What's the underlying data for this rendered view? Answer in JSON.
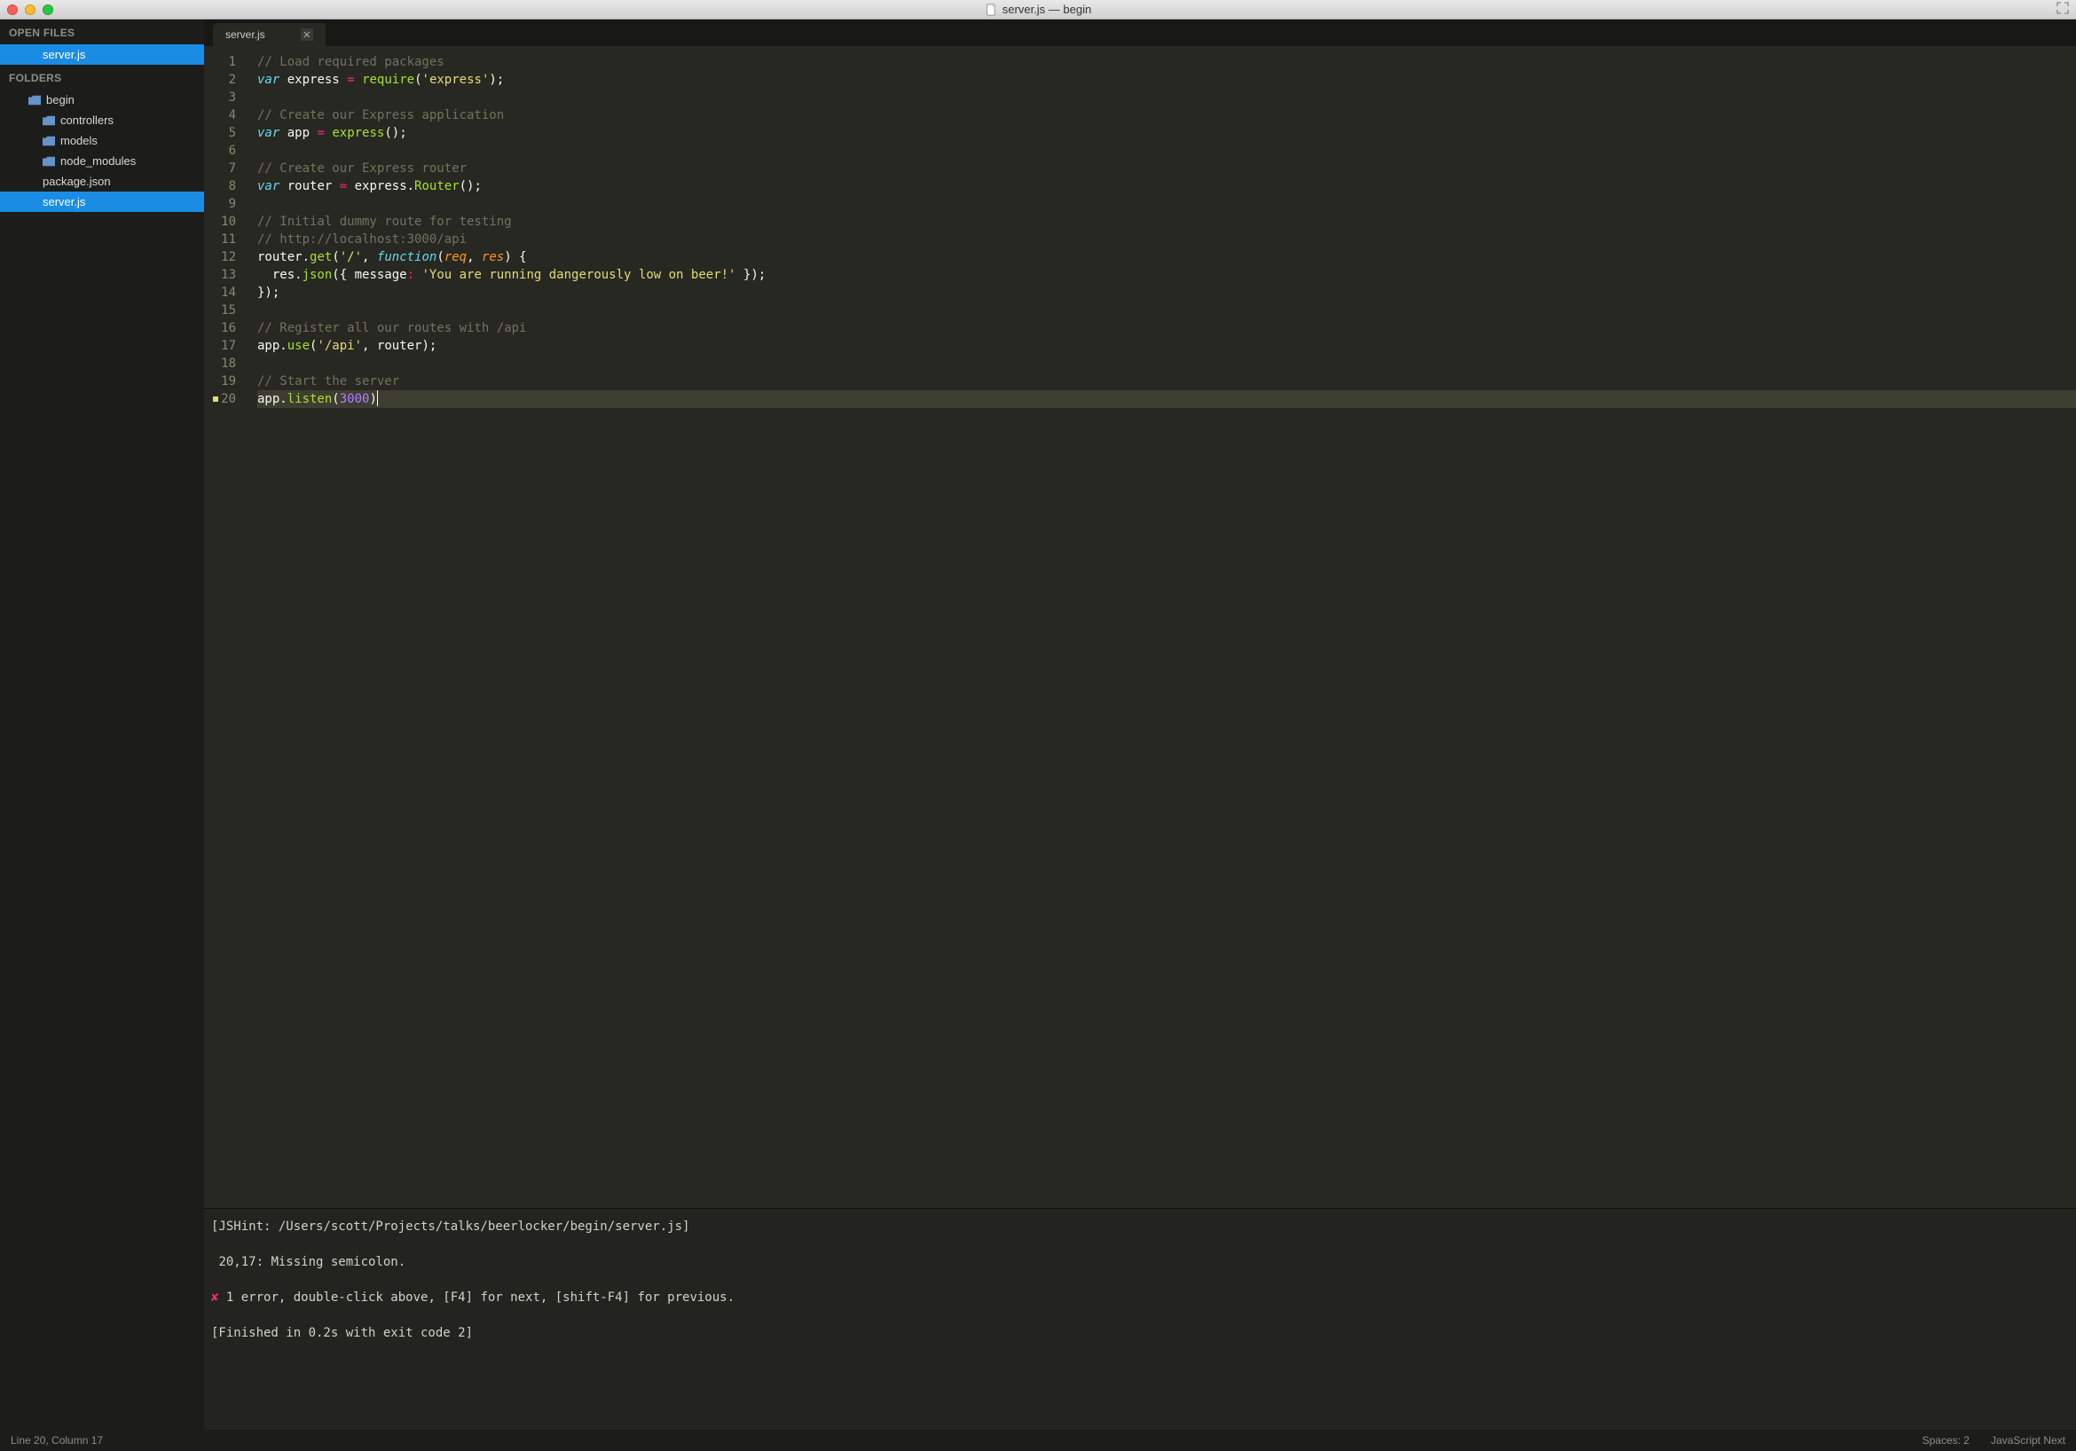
{
  "window": {
    "title": "server.js — begin"
  },
  "sidebar": {
    "open_files_label": "OPEN FILES",
    "folders_label": "FOLDERS",
    "open_files": [
      {
        "name": "server.js",
        "selected": true
      }
    ],
    "root_folder": "begin",
    "tree": [
      {
        "name": "controllers",
        "type": "folder"
      },
      {
        "name": "models",
        "type": "folder"
      },
      {
        "name": "node_modules",
        "type": "folder"
      },
      {
        "name": "package.json",
        "type": "file"
      },
      {
        "name": "server.js",
        "type": "file",
        "selected": true
      }
    ]
  },
  "tabs": [
    {
      "label": "server.js"
    }
  ],
  "code": {
    "lines": [
      [
        {
          "t": "// Load required packages",
          "c": "comment"
        }
      ],
      [
        {
          "t": "var",
          "c": "keyword"
        },
        {
          "t": " ",
          "c": "default"
        },
        {
          "t": "express",
          "c": "default"
        },
        {
          "t": " ",
          "c": "default"
        },
        {
          "t": "=",
          "c": "keyword2"
        },
        {
          "t": " ",
          "c": "default"
        },
        {
          "t": "require",
          "c": "func"
        },
        {
          "t": "(",
          "c": "default"
        },
        {
          "t": "'express'",
          "c": "string"
        },
        {
          "t": ");",
          "c": "default"
        }
      ],
      [],
      [
        {
          "t": "// Create our Express application",
          "c": "comment"
        }
      ],
      [
        {
          "t": "var",
          "c": "keyword"
        },
        {
          "t": " ",
          "c": "default"
        },
        {
          "t": "app",
          "c": "default"
        },
        {
          "t": " ",
          "c": "default"
        },
        {
          "t": "=",
          "c": "keyword2"
        },
        {
          "t": " ",
          "c": "default"
        },
        {
          "t": "express",
          "c": "func"
        },
        {
          "t": "();",
          "c": "default"
        }
      ],
      [],
      [
        {
          "t": "// Create our Express router",
          "c": "comment"
        }
      ],
      [
        {
          "t": "var",
          "c": "keyword"
        },
        {
          "t": " ",
          "c": "default"
        },
        {
          "t": "router",
          "c": "default"
        },
        {
          "t": " ",
          "c": "default"
        },
        {
          "t": "=",
          "c": "keyword2"
        },
        {
          "t": " express.",
          "c": "default"
        },
        {
          "t": "Router",
          "c": "func"
        },
        {
          "t": "();",
          "c": "default"
        }
      ],
      [],
      [
        {
          "t": "// Initial dummy route for testing",
          "c": "comment"
        }
      ],
      [
        {
          "t": "// http://localhost:3000/api",
          "c": "comment"
        }
      ],
      [
        {
          "t": "router.",
          "c": "default"
        },
        {
          "t": "get",
          "c": "func"
        },
        {
          "t": "(",
          "c": "default"
        },
        {
          "t": "'/'",
          "c": "string"
        },
        {
          "t": ", ",
          "c": "default"
        },
        {
          "t": "function",
          "c": "keyword"
        },
        {
          "t": "(",
          "c": "default"
        },
        {
          "t": "req",
          "c": "param"
        },
        {
          "t": ", ",
          "c": "default"
        },
        {
          "t": "res",
          "c": "param"
        },
        {
          "t": ") {",
          "c": "default"
        }
      ],
      [
        {
          "t": "  res.",
          "c": "default"
        },
        {
          "t": "json",
          "c": "func"
        },
        {
          "t": "({ message",
          "c": "default"
        },
        {
          "t": ":",
          "c": "keyword2"
        },
        {
          "t": " ",
          "c": "default"
        },
        {
          "t": "'You are running dangerously low on beer!'",
          "c": "string"
        },
        {
          "t": " });",
          "c": "default"
        }
      ],
      [
        {
          "t": "});",
          "c": "default"
        }
      ],
      [],
      [
        {
          "t": "// Register all our routes with /api",
          "c": "comment"
        }
      ],
      [
        {
          "t": "app.",
          "c": "default"
        },
        {
          "t": "use",
          "c": "func"
        },
        {
          "t": "(",
          "c": "default"
        },
        {
          "t": "'/api'",
          "c": "string"
        },
        {
          "t": ", router);",
          "c": "default"
        }
      ],
      [],
      [
        {
          "t": "// Start the server",
          "c": "comment"
        }
      ],
      [
        {
          "t": "app.",
          "c": "default"
        },
        {
          "t": "listen",
          "c": "func"
        },
        {
          "t": "(",
          "c": "default"
        },
        {
          "t": "3000",
          "c": "num"
        },
        {
          "t": ")",
          "c": "default"
        }
      ]
    ],
    "current_line": 20,
    "marker_line": 20
  },
  "console": {
    "lines": [
      "[JSHint: /Users/scott/Projects/talks/beerlocker/begin/server.js]",
      "",
      " 20,17: Missing semicolon.",
      "",
      "✘ 1 error, double-click above, [F4] for next, [shift-F4] for previous.",
      "",
      "[Finished in 0.2s with exit code 2]"
    ]
  },
  "statusbar": {
    "position": "Line 20, Column 17",
    "spaces": "Spaces: 2",
    "language": "JavaScript Next"
  }
}
